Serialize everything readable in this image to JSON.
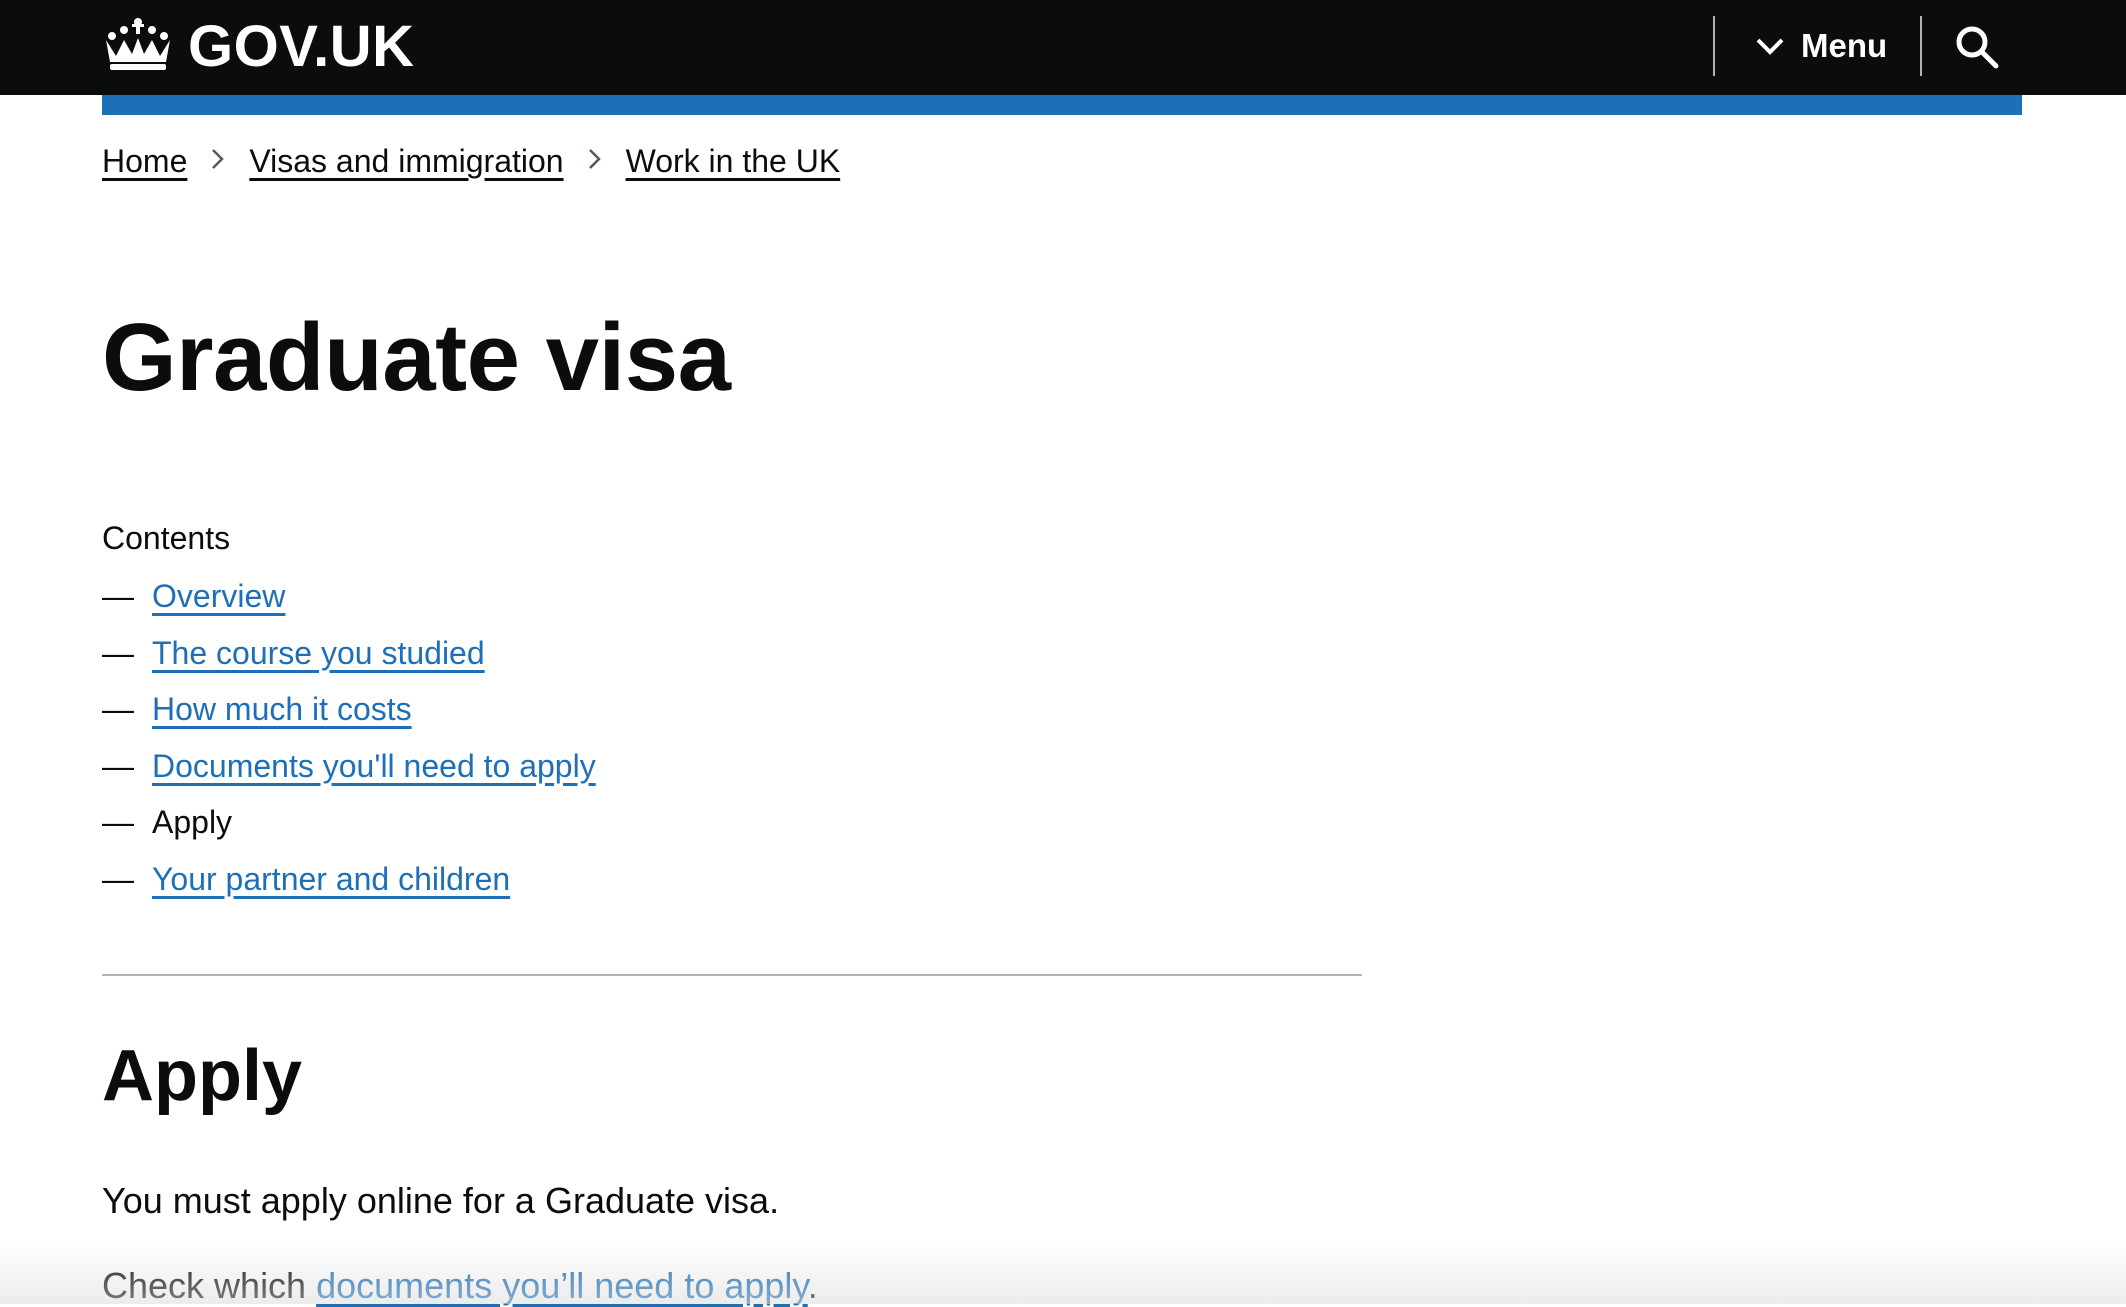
{
  "header": {
    "logo_text": "GOV.UK",
    "menu_label": "Menu",
    "colors": {
      "background": "#0b0c0c",
      "accent_bar": "#1d70b8"
    }
  },
  "breadcrumbs": [
    {
      "label": "Home"
    },
    {
      "label": "Visas and immigration"
    },
    {
      "label": "Work in the UK"
    }
  ],
  "page": {
    "title": "Graduate visa"
  },
  "contents": {
    "label": "Contents",
    "items": [
      {
        "label": "Overview",
        "link": true
      },
      {
        "label": "The course you studied",
        "link": true
      },
      {
        "label": "How much it costs",
        "link": true
      },
      {
        "label": "Documents you'll need to apply",
        "link": true
      },
      {
        "label": "Apply",
        "link": false
      },
      {
        "label": "Your partner and children",
        "link": true
      }
    ],
    "dash": "—"
  },
  "section": {
    "title": "Apply",
    "para1": "You must apply online for a Graduate visa.",
    "para2_prefix": "Check which ",
    "para2_link": "documents you’ll need to apply",
    "para2_suffix": "."
  },
  "colors": {
    "link": "#1d70b8",
    "text": "#0b0c0c",
    "divider": "#b1b4b6"
  },
  "icons": [
    "crown-icon",
    "chevron-down-icon",
    "search-icon",
    "chevron-right-icon"
  ]
}
